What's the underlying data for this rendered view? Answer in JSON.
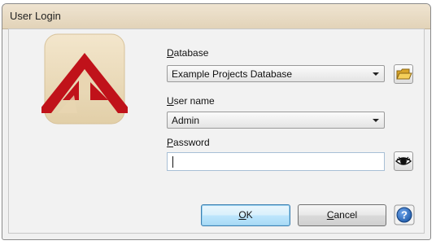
{
  "window": {
    "title": "User Login"
  },
  "form": {
    "database": {
      "label_access": "D",
      "label_rest": "atabase",
      "value": "Example Projects Database"
    },
    "username": {
      "label_access": "U",
      "label_rest": "ser name",
      "value": "Admin"
    },
    "password": {
      "label_access": "P",
      "label_rest": "assword",
      "value": ""
    }
  },
  "buttons": {
    "ok_access": "O",
    "ok_rest": "K",
    "cancel_access": "C",
    "cancel_rest": "ancel"
  },
  "icons": {
    "logo": "kd-logo",
    "browse": "folder-icon",
    "toggle_password": "eye-icon",
    "help": "help-icon"
  },
  "colors": {
    "title_bar": "#e6d8bf",
    "logo_red": "#c0121a",
    "logo_bg": "#ecdcbf",
    "ok_blue": "#bee6fd",
    "help_blue": "#1f5aa8"
  }
}
